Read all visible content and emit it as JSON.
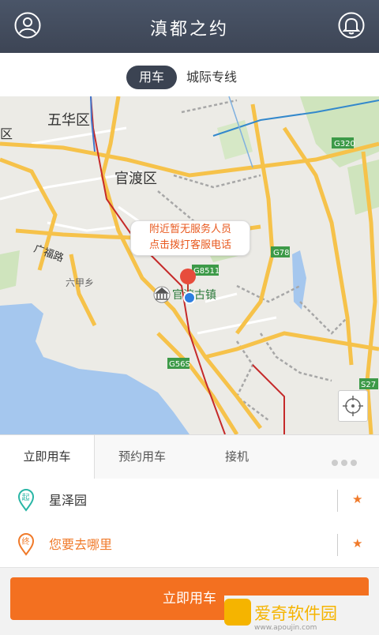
{
  "header": {
    "title": "滇都之约"
  },
  "modes": {
    "active": "用车",
    "other": "城际专线"
  },
  "map": {
    "labels": {
      "wuhua": "五华区",
      "guandu": "官渡区",
      "qu_left": "区",
      "guangfu": "广福路",
      "liujia": "六甲乡",
      "guandu_town": "官渡古镇",
      "g320": "G320",
      "g78": "G78",
      "g8511": "G8511",
      "g56s": "G56S",
      "s27": "S27"
    },
    "callout": {
      "line1": "附近暂无服务人员",
      "line2": "点击拨打客服电话"
    }
  },
  "tabs": [
    "立即用车",
    "预约用车",
    "接机"
  ],
  "start": {
    "badge": "起",
    "value": "星泽园"
  },
  "end": {
    "badge": "终",
    "placeholder": "您要去哪里"
  },
  "cta": "立即用车",
  "watermark": {
    "text": "爱奇软件园",
    "url": "www.apoujin.com"
  },
  "colors": {
    "accent": "#f37020",
    "header": "#4a5568",
    "start_green": "#2ab6a6",
    "end_orange": "#f07a2a"
  }
}
